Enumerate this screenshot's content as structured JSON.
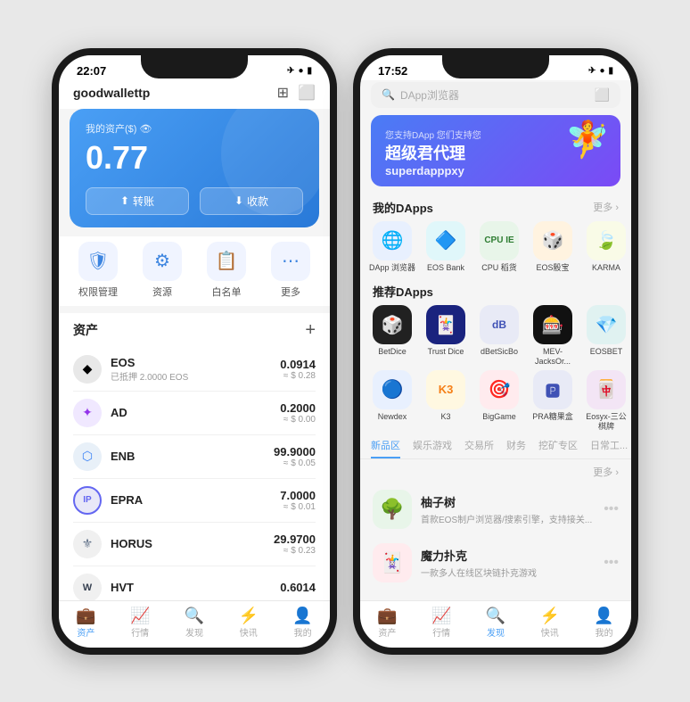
{
  "phone1": {
    "status": {
      "time": "22:07",
      "icons": "✈ ● ▮"
    },
    "header": {
      "wallet_name": "goodwallettp",
      "chevron": "›",
      "icon1": "⊞",
      "icon2": "⬜"
    },
    "balance_card": {
      "label": "我的资产($) 👁",
      "amount": "0.77",
      "transfer_btn": "转账",
      "receive_btn": "收款"
    },
    "menu": [
      {
        "icon": "🛡",
        "label": "权限管理"
      },
      {
        "icon": "⚙",
        "label": "资源"
      },
      {
        "icon": "📋",
        "label": "白名单"
      },
      {
        "icon": "⋯",
        "label": "更多"
      }
    ],
    "assets_title": "资产",
    "assets": [
      {
        "symbol": "EOS",
        "sub": "已抵押 2.0000 EOS",
        "amount": "0.0914",
        "usd": "≈ $ 0.28",
        "color": "#777"
      },
      {
        "symbol": "AD",
        "sub": "",
        "amount": "0.2000",
        "usd": "≈ $ 0.00",
        "color": "#a855f7"
      },
      {
        "symbol": "ENB",
        "sub": "",
        "amount": "99.9000",
        "usd": "≈ $ 0.05",
        "color": "#60a5fa"
      },
      {
        "symbol": "EPRA",
        "sub": "",
        "amount": "7.0000",
        "usd": "≈ $ 0.01",
        "color": "#6366f1"
      },
      {
        "symbol": "HORUS",
        "sub": "",
        "amount": "29.9700",
        "usd": "≈ $ 0.23",
        "color": "#64748b"
      },
      {
        "symbol": "HVT",
        "sub": "",
        "amount": "0.6014",
        "usd": "",
        "color": "#374151"
      }
    ],
    "tabs": [
      {
        "icon": "💼",
        "label": "资产",
        "active": true
      },
      {
        "icon": "📈",
        "label": "行情",
        "active": false
      },
      {
        "icon": "🔍",
        "label": "发现",
        "active": false
      },
      {
        "icon": "⚡",
        "label": "快讯",
        "active": false
      },
      {
        "icon": "👤",
        "label": "我的",
        "active": false
      }
    ]
  },
  "phone2": {
    "status": {
      "time": "17:52",
      "icons": "✈ ● ▮"
    },
    "search_placeholder": "DApp浏览器",
    "banner": {
      "badge": "您支持DApp 您们支持您",
      "title": "超级君代理",
      "subtitle": "superdapppxy"
    },
    "my_dapps": {
      "title": "我的DApps",
      "more": "更多 ›",
      "apps": [
        {
          "label": "DApp\n浏览器",
          "icon": "🌐",
          "color": "icon-blue"
        },
        {
          "label": "EOS Bank",
          "icon": "🔷",
          "color": "icon-cyan"
        },
        {
          "label": "CPU 稻货",
          "icon": "⬜",
          "color": "icon-green"
        },
        {
          "label": "EOS骰宝",
          "icon": "🎲",
          "color": "icon-orange"
        },
        {
          "label": "KARMA",
          "icon": "🍃",
          "color": "icon-lime"
        }
      ]
    },
    "recommended_dapps": {
      "title": "推荐DApps",
      "apps": [
        {
          "label": "BetDice",
          "icon": "🎲",
          "color": "icon-dark"
        },
        {
          "label": "Trust Dice",
          "icon": "🃏",
          "color": "icon-dark"
        },
        {
          "label": "dBetSicBo",
          "icon": "🎮",
          "color": "icon-indigo"
        },
        {
          "label": "MEV-JacksOr...",
          "icon": "🎰",
          "color": "icon-dark"
        },
        {
          "label": "EOSBET",
          "icon": "💎",
          "color": "icon-teal"
        },
        {
          "label": "Newdex",
          "icon": "🔵",
          "color": "icon-blue"
        },
        {
          "label": "K3",
          "icon": "K3",
          "color": "icon-amber"
        },
        {
          "label": "BigGame",
          "icon": "🎯",
          "color": "icon-red"
        },
        {
          "label": "PRA糖果盒",
          "icon": "🅿",
          "color": "icon-indigo"
        },
        {
          "label": "Eosyx-三公棋牌",
          "icon": "🀄",
          "color": "icon-purple"
        }
      ]
    },
    "category_tabs": [
      {
        "label": "新品区",
        "active": true
      },
      {
        "label": "娱乐游戏",
        "active": false
      },
      {
        "label": "交易所",
        "active": false
      },
      {
        "label": "财务",
        "active": false
      },
      {
        "label": "挖矿专区",
        "active": false
      },
      {
        "label": "日常工...",
        "active": false
      }
    ],
    "new_apps": {
      "more": "更多 ›",
      "items": [
        {
          "name": "柚子树",
          "desc": "首款EOS制户浏览器/搜索引擎，支持接关...",
          "icon": "🌳",
          "bg": "#e8f5e9"
        },
        {
          "name": "魔力扑克",
          "desc": "一款多人在线区块链扑克游戏",
          "icon": "🃏",
          "bg": "#ffebee"
        }
      ]
    },
    "tabs": [
      {
        "icon": "💼",
        "label": "资产",
        "active": false
      },
      {
        "icon": "📈",
        "label": "行情",
        "active": false
      },
      {
        "icon": "🔍",
        "label": "发现",
        "active": true
      },
      {
        "icon": "⚡",
        "label": "快讯",
        "active": false
      },
      {
        "icon": "👤",
        "label": "我的",
        "active": false
      }
    ]
  }
}
